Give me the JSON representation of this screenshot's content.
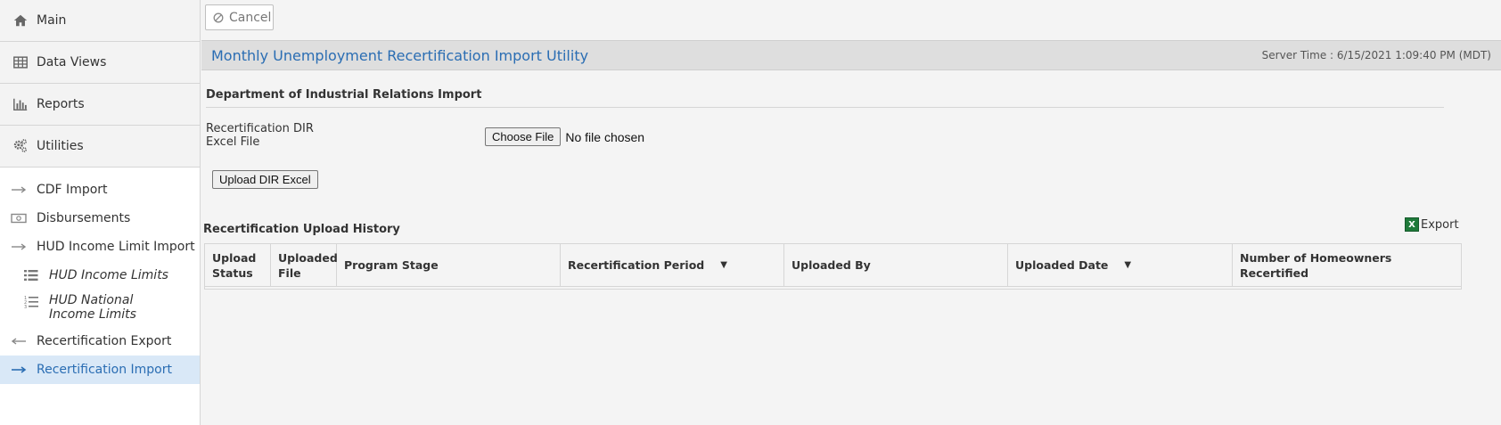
{
  "sidebar": {
    "main": [
      {
        "label": "Main",
        "icon": "home-icon"
      },
      {
        "label": "Data Views",
        "icon": "table-icon"
      },
      {
        "label": "Reports",
        "icon": "bar-chart-icon"
      },
      {
        "label": "Utilities",
        "icon": "gears-icon"
      }
    ],
    "sub": [
      {
        "label": "CDF Import",
        "icon": "arrow-right-icon"
      },
      {
        "label": "Disbursements",
        "icon": "money-icon"
      },
      {
        "label": "HUD Income Limit Import",
        "icon": "arrow-right-icon"
      },
      {
        "label": "HUD Income Limits",
        "icon": "list-icon"
      },
      {
        "label": "HUD National Income Limits",
        "icon": "numbered-list-icon"
      },
      {
        "label": "Recertification Export",
        "icon": "arrow-left-icon"
      },
      {
        "label": "Recertification Import",
        "icon": "arrow-right-icon"
      }
    ]
  },
  "toolbar": {
    "cancel_label": "Cancel"
  },
  "page": {
    "title": "Monthly Unemployment Recertification Import Utility",
    "server_time": "Server Time : 6/15/2021 1:09:40 PM (MDT)",
    "section_title": "Department of Industrial Relations Import",
    "file_label": "Recertification DIR Excel File",
    "choose_file_label": "Choose File",
    "file_status": "No file chosen",
    "upload_label": "Upload DIR Excel",
    "history_title": "Recertification Upload History",
    "export_label": "Export"
  },
  "grid": {
    "columns": [
      "Upload Status",
      "Uploaded File",
      "Program Stage",
      "Recertification Period",
      "Uploaded By",
      "Uploaded Date",
      "Number of Homeowners Recertified"
    ]
  }
}
